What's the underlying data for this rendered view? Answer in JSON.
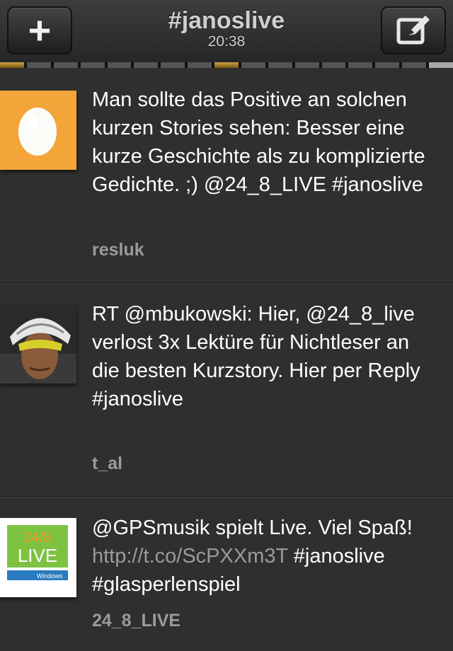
{
  "header": {
    "title": "#janoslive",
    "time": "20:38",
    "left_button_icon": "plus-icon",
    "right_button_icon": "compose-icon"
  },
  "progress": {
    "segments": 17,
    "highlighted_index": 16
  },
  "tweets": [
    {
      "avatar": "egg-avatar",
      "text": "Man sollte das Positive an solchen kurzen Stories sehen: Besser eine kurze Geschichte als zu komplizierte Gedichte. ;) @24_8_LIVE #janoslive",
      "link": "",
      "after_link": "",
      "user": "resluk"
    },
    {
      "avatar": "cyclist-avatar",
      "text": "RT @mbukowski: Hier, @24_8_live verlost 3x Lektüre für Nichtleser an die besten Kurzstory. Hier per Reply #janoslive",
      "link": "",
      "after_link": "",
      "user": "t_al"
    },
    {
      "avatar": "248live-logo",
      "text": "@GPSmusik spielt Live. Viel Spaß! ",
      "link": "http://t.co/ScPXXm3T",
      "after_link": " #janoslive #glasperlenspiel",
      "logo_top": "24/8",
      "logo_main": "LIVE",
      "logo_bottom": "Windows",
      "user": "24_8_LIVE"
    }
  ],
  "colors": {
    "background": "#2f2f2f",
    "egg_bg": "#f4a53a",
    "username": "#9b9b9b",
    "link": "#9a9a9a"
  }
}
